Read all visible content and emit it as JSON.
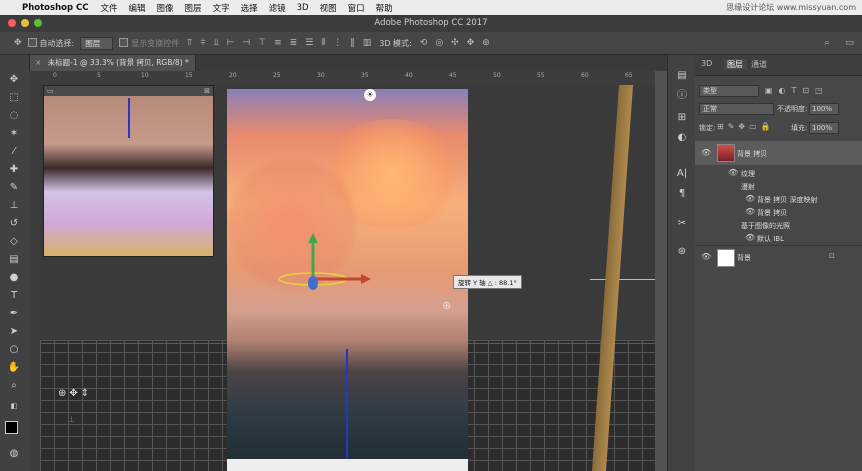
{
  "menubar": {
    "app": "Photoshop CC",
    "items": [
      "文件",
      "编辑",
      "图像",
      "图层",
      "文字",
      "选择",
      "滤镜",
      "3D",
      "视图",
      "窗口",
      "帮助"
    ],
    "watermark": "思缘设计论坛 www.missyuan.com"
  },
  "titlebar": {
    "title": "Adobe Photoshop CC 2017"
  },
  "options": {
    "auto_select_label": "自动选择:",
    "auto_select_value": "图层",
    "show_transform_label": "显示变换控件",
    "mode_3d_label": "3D 模式:"
  },
  "document": {
    "tab_label": "未标题-1 @ 33.3% (背景 拷贝, RGB/8) *"
  },
  "ruler": {
    "h_numbers": [
      "0",
      "5",
      "10",
      "15",
      "20",
      "25",
      "30",
      "35",
      "40",
      "45",
      "50",
      "55",
      "60",
      "65"
    ]
  },
  "tooltip": {
    "text": "旋转 Y 轴 △ : 88.1°"
  },
  "panels": {
    "tabs": [
      "3D",
      "图层",
      "通道"
    ],
    "active_tab": "图层",
    "kind_filter": "类型",
    "blend_mode": "正常",
    "opacity_label": "不透明度:",
    "opacity_value": "100%",
    "lock_label": "锁定:",
    "fill_label": "填充:",
    "fill_value": "100%",
    "layers": [
      {
        "name": "背景 拷贝"
      },
      {
        "name": "纹理"
      },
      {
        "name": "漫射"
      },
      {
        "name": "背景 拷贝 深度映射"
      },
      {
        "name": "背景 拷贝"
      },
      {
        "name": "基于图像的光照"
      },
      {
        "name": "默认 IBL"
      },
      {
        "name": "背景"
      }
    ]
  },
  "colors": {
    "accent": "#2a35c8",
    "bg": "#535353"
  }
}
